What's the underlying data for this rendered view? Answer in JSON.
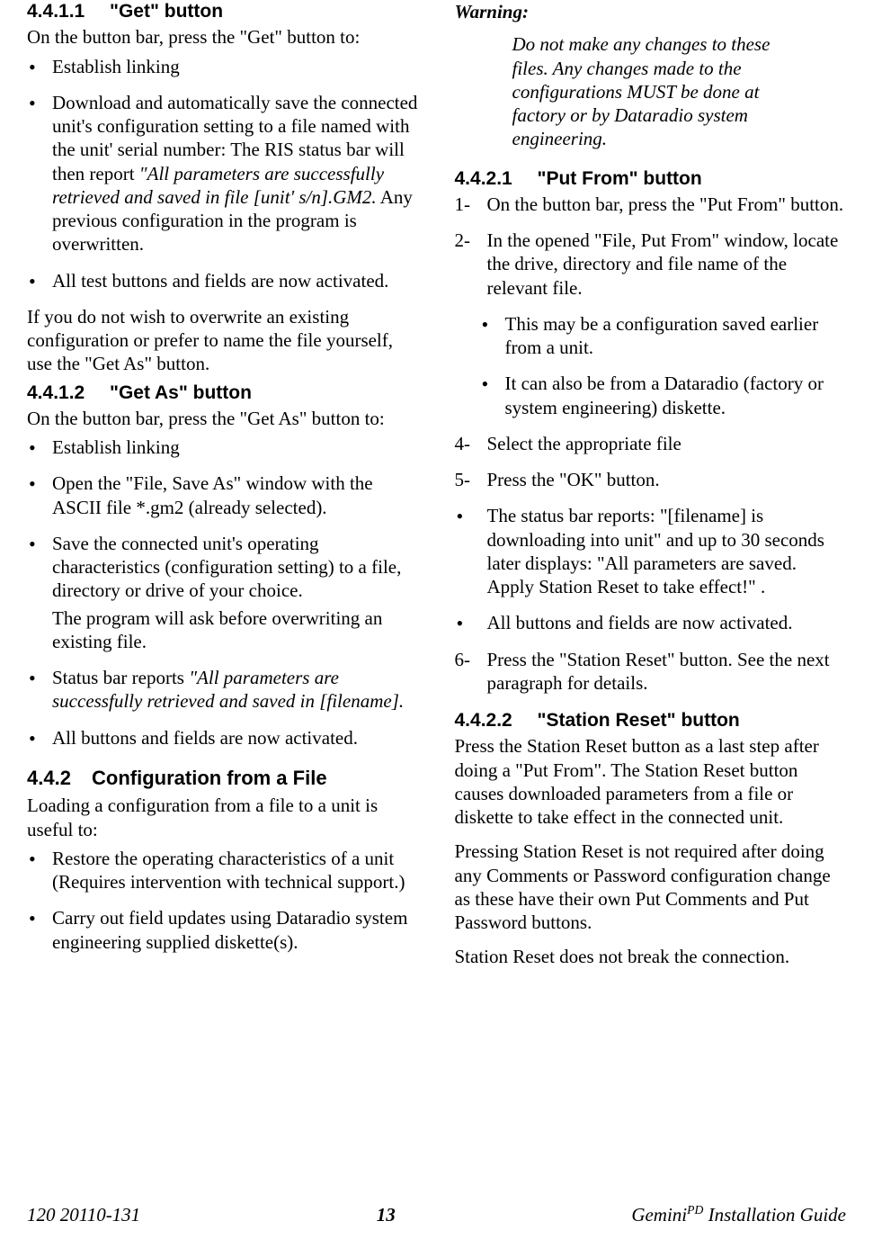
{
  "left": {
    "h_4411_num": "4.4.1.1",
    "h_4411_title": "\"Get\" button",
    "p_get_intro": "On the button bar, press the \"Get\" button to:",
    "get_b1": "Establish linking",
    "get_b2a": "Download and automatically save the connected unit's configuration setting to a file named with the unit' serial number: The RIS status bar will then report ",
    "get_b2_it": "\"All parameters are successfully retrieved and saved in file [unit' s/n].GM2.",
    "get_b2b": " Any previous configuration in the program is overwritten.",
    "get_b3": "All test buttons and fields are now activated.",
    "p_get_note": "If you do not wish to overwrite an existing configuration or prefer to name the file yourself, use the \"Get As\" button.",
    "h_4412_num": "4.4.1.2",
    "h_4412_title": "\"Get As\" button",
    "p_getas_intro": "On the button bar, press the \"Get As\" button to:",
    "ga_b1": "Establish linking",
    "ga_b2": "Open the \"File, Save As\" window with the ASCII file *.gm2 (already selected).",
    "ga_b3": "Save the connected unit's operating characteristics (configuration setting) to a file, directory or drive of your choice.",
    "ga_b3_sub": "The program will ask before overwriting an existing file.",
    "ga_b4a": "Status bar reports ",
    "ga_b4_it": "\"All parameters are successfully retrieved and saved in [filename].",
    "ga_b5": "All buttons and fields are now activated.",
    "h_442_num": "4.4.2",
    "h_442_title": "Configuration from a File",
    "p_442_intro": "Loading a configuration from a file to a unit is useful to:",
    "cf_b1": "Restore the operating characteristics of a unit (Requires intervention with technical support.)",
    "cf_b2": "Carry out field updates using Dataradio system engineering supplied diskette(s)."
  },
  "right": {
    "warn_h": "Warning:",
    "warn_body": "Do not make any changes to these files. Any changes made to the configurations MUST be done at factory or by Dataradio system engineering.",
    "h_4421_num": "4.4.2.1",
    "h_4421_title": "\"Put From\" button",
    "pf_1_mk": "1-",
    "pf_1": "On the button bar, press the \"Put From\" button.",
    "pf_2_mk": "2-",
    "pf_2": "In the opened \"File, Put From\" window, locate the drive, directory and file name of the relevant file.",
    "pf_2_sub1": "This may be a configuration saved earlier from a unit.",
    "pf_2_sub2": "It can also be from a Dataradio (factory or system engineering) diskette.",
    "pf_4_mk": "4-",
    "pf_4": "Select the appropriate file",
    "pf_5_mk": "5-",
    "pf_5": "Press the \"OK\" button.",
    "pf_b_status": "The status bar reports: \"[filename] is downloading into unit\" and up to 30 seconds later displays: \"All parameters are saved. Apply Station Reset to take effect!\" .",
    "pf_b_act": "All buttons and fields are now activated.",
    "pf_6_mk": "6-",
    "pf_6": "Press the \"Station Reset\" button. See the next paragraph for details.",
    "h_4422_num": "4.4.2.2",
    "h_4422_title": "\"Station Reset\" button",
    "sr_p1": "Press the Station Reset button as a last step after doing a \"Put From\". The Station Reset button causes downloaded parameters from a file or diskette to take effect in the connected unit.",
    "sr_p2": "Pressing Station Reset is not required after doing any Comments or Password configuration change as these have their own Put Comments and Put Password buttons.",
    "sr_p3": "Station Reset does not break the connection."
  },
  "footer": {
    "left": "120 20110-131",
    "center": "13",
    "right_a": "Gemini",
    "right_sup": "PD",
    "right_b": " Installation Guide"
  }
}
